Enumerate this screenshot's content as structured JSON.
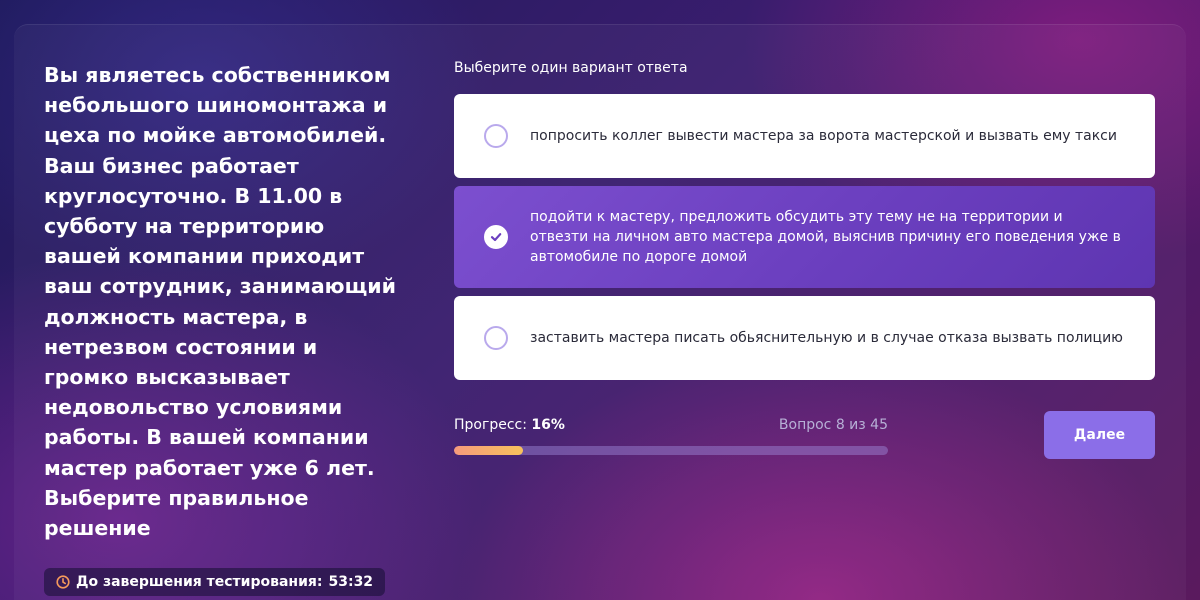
{
  "question": {
    "text": "Вы являетесь собственником небольшого шиномонтажа и цеха по мойке автомобилей. Ваш бизнес работает круглосуточно. В 11.00 в субботу на территорию вашей компании приходит ваш сотрудник, занимающий должность мастера, в нетрезвом состоянии и громко высказывает недовольство условиями работы. В вашей компании мастер работает уже 6 лет. Выберите правильное решение"
  },
  "timer": {
    "icon": "clock-icon",
    "label": "До завершения тестирования:",
    "value": "53:32",
    "color": "#f59a5c"
  },
  "answers": {
    "prompt": "Выберите один вариант ответа",
    "options": [
      {
        "text": "попросить коллег вывести мастера за ворота мастерской и вызвать ему такси",
        "selected": false
      },
      {
        "text": "подойти к мастеру, предложить обсудить эту тему не на территории и отвезти на личном авто мастера домой, выяснив причину его поведения уже в автомобиле по дороге домой",
        "selected": true
      },
      {
        "text": "заставить мастера писать обьяснительную и в случае отказа вызвать полицию",
        "selected": false
      }
    ]
  },
  "progress": {
    "label": "Прогресс:",
    "percent_text": "16%",
    "fraction": 0.16,
    "counter": "Вопрос 8 из 45"
  },
  "next_button": {
    "label": "Далее"
  },
  "colors": {
    "accent": "#8b6ee8",
    "selected_option": "#6b3fbf",
    "progress_fill": "#f7c25c"
  }
}
